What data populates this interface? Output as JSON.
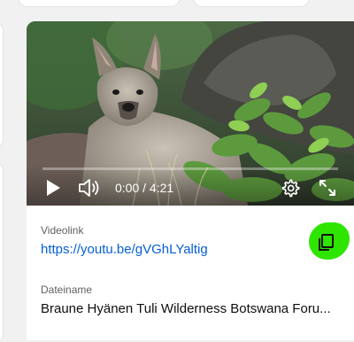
{
  "player": {
    "time_display": "0:00 / 4:21",
    "progress_fraction": 0,
    "accent_color": "#ff0000",
    "controls": {
      "play_icon": "play-icon",
      "volume_icon": "volume-icon",
      "settings_icon": "settings-gear-icon",
      "fullscreen_icon": "fullscreen-icon"
    }
  },
  "share": {
    "video_link_label": "Videolink",
    "video_link_url": "https://youtu.be/gVGhLYaltig",
    "copy_icon": "copy-icon",
    "highlight_color": "#2ee500",
    "link_color": "#065fd4",
    "file_name_label": "Dateiname",
    "file_name_value": "Braune Hyänen Tuli Wilderness Botswana Foru..."
  }
}
